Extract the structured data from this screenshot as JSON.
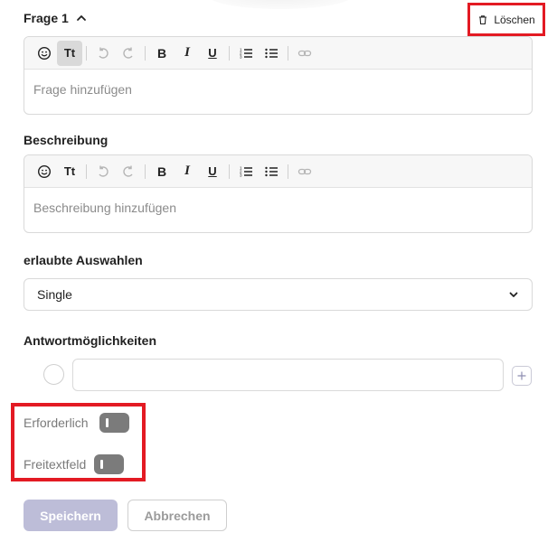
{
  "question": {
    "title": "Frage 1",
    "delete_label": "Löschen"
  },
  "question_editor": {
    "toolbar": [
      {
        "name": "emoji-icon",
        "kind": "emoji",
        "active": false,
        "disabled": false
      },
      {
        "name": "text-style-icon",
        "kind": "text",
        "label": "Tt",
        "active": true,
        "disabled": false
      },
      {
        "name": "undo-icon",
        "kind": "undo",
        "active": false,
        "disabled": true
      },
      {
        "name": "redo-icon",
        "kind": "redo",
        "active": false,
        "disabled": true
      },
      {
        "name": "bold-icon",
        "kind": "text",
        "label": "B",
        "active": false,
        "disabled": false
      },
      {
        "name": "italic-icon",
        "kind": "text",
        "label": "I",
        "active": false,
        "disabled": false
      },
      {
        "name": "underline-icon",
        "kind": "text",
        "label": "U",
        "active": false,
        "disabled": false
      },
      {
        "name": "ordered-list-icon",
        "kind": "olist",
        "active": false,
        "disabled": false
      },
      {
        "name": "bullet-list-icon",
        "kind": "ulist",
        "active": false,
        "disabled": false
      },
      {
        "name": "link-icon",
        "kind": "link",
        "active": false,
        "disabled": true
      }
    ],
    "placeholder": "Frage hinzufügen"
  },
  "description": {
    "label": "Beschreibung",
    "placeholder": "Beschreibung hinzufügen"
  },
  "allowed_choices": {
    "label": "erlaubte Auswahlen",
    "selected": "Single"
  },
  "answers": {
    "label": "Antwortmöglichkeiten",
    "input_value": ""
  },
  "toggles": {
    "required_label": "Erforderlich",
    "required_on": false,
    "freetext_label": "Freitextfeld",
    "freetext_on": false
  },
  "actions": {
    "save_label": "Speichern",
    "cancel_label": "Abbrechen"
  },
  "colors": {
    "highlight": "#e31a23",
    "toggle_off": "#7b7b7b",
    "save_disabled": "#bdbdd8"
  }
}
